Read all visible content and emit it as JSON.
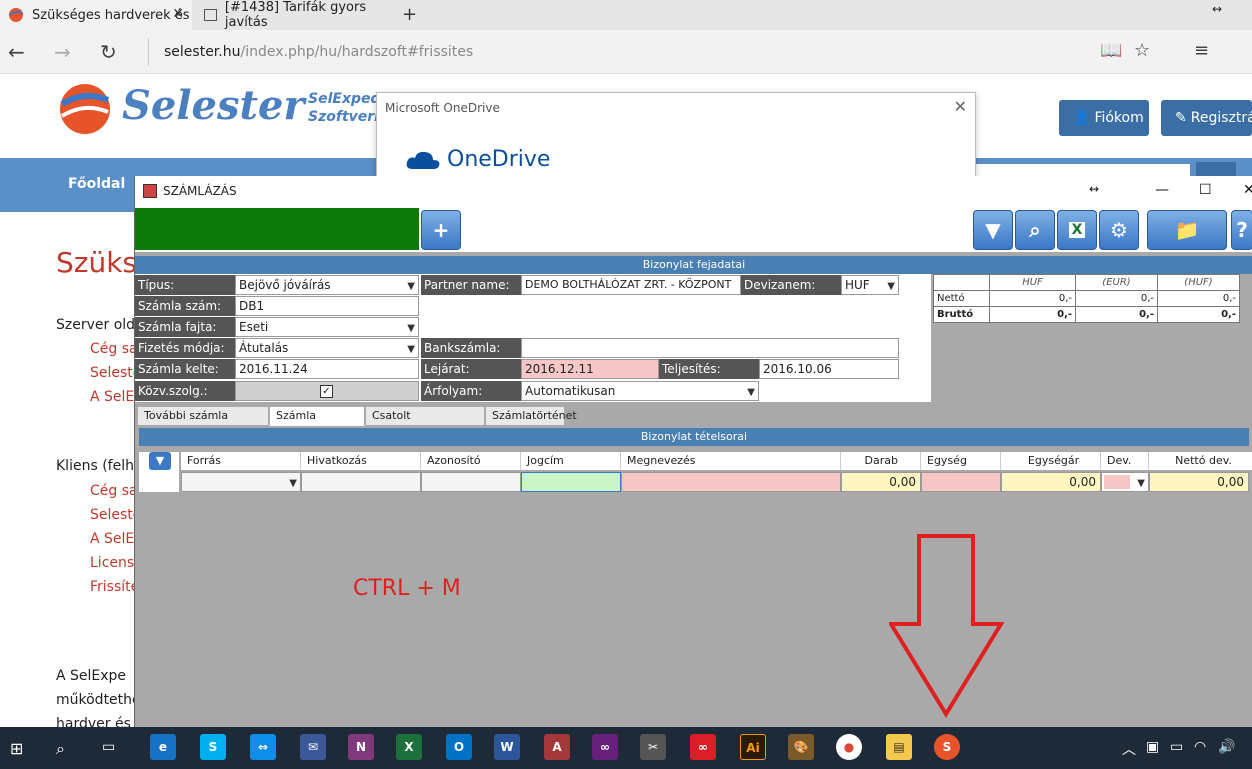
{
  "browser": {
    "tabs": [
      {
        "title": "Szükséges hardverek és"
      },
      {
        "title": "[#1438] Tarifák gyors javítás"
      }
    ],
    "url_host": "selester.hu",
    "url_path": "/index.php/hu/hardszoft#frissites"
  },
  "site": {
    "logo": "Selester",
    "tagline_1": "SelExped",
    "tagline_2": "Szoftverr",
    "account_button": "Fiókom",
    "register_button": "Regisztrác",
    "nav_home": "Főoldal",
    "heading": "Szüks",
    "server_label": "Szerver olda",
    "server_links": [
      "Cég sa",
      "Seleste",
      "A SelEx"
    ],
    "client_label": "Kliens (felha",
    "client_links": [
      "Cég sa",
      "Seleste",
      "A SelEx",
      "Licensz",
      "Frissíté"
    ],
    "bottom_text": [
      "A  SelExpe",
      "működtethe",
      "hardver és s"
    ]
  },
  "onedrive": {
    "title": "Microsoft OneDrive",
    "brand": "OneDrive"
  },
  "app": {
    "title": "SZÁMLÁZÁS",
    "header_section": "Bizonylat fejadatai",
    "labels": {
      "type": "Típus:",
      "invoice_no": "Számla szám:",
      "invoice_kind": "Számla fajta:",
      "payment": "Fizetés módja:",
      "issue_date": "Számla kelte:",
      "public_service": "Közv.szolg.:",
      "partner": "Partner name:",
      "currency": "Devizanem:",
      "bank": "Bankszámla:",
      "due": "Lejárat:",
      "fulfil": "Teljesítés:",
      "rate": "Árfolyam:"
    },
    "values": {
      "type": "Bejövő jóváírás",
      "invoice_no": "DB1",
      "invoice_kind": "Eseti",
      "payment": "Átutalás",
      "issue_date": "2016.11.24",
      "partner": "DEMO BOLTHÁLÓZAT ZRT. - KÖZPONT",
      "currency": "HUF",
      "bank": "",
      "due": "2016.12.11",
      "fulfil": "2016.10.06",
      "rate": "Automatikusan",
      "public_service_checked": "☑"
    },
    "summary": {
      "cols": [
        "HUF",
        "(EUR)",
        "(HUF)"
      ],
      "rows": [
        {
          "label": "Nettó",
          "vals": [
            "0,-",
            "0,-",
            "0,-"
          ]
        },
        {
          "label": "Bruttó",
          "vals": [
            "0,-",
            "0,-",
            "0,-"
          ]
        }
      ]
    },
    "subtabs": [
      "További számla fejadatok",
      "Számla tételsorok",
      "Csatolt dokumentumok",
      "Számlatörténet"
    ],
    "items_section": "Bizonylat tételsorai",
    "grid_headers": [
      "Forrás",
      "Hivatkozás",
      "Azonosító",
      "Jogcím",
      "Megnevezés",
      "Darab",
      "Egység",
      "Egységár",
      "Dev.",
      "Nettó dev."
    ],
    "grid_row": {
      "darab": "0,00",
      "egysegar": "0,00",
      "netto": "0,00"
    },
    "overlay_text": "CTRL + M"
  },
  "colors": {
    "accent": "#4a7fb4",
    "green": "#0b7a0b",
    "pink": "#f7c6c6",
    "annotation": "#e02020"
  }
}
